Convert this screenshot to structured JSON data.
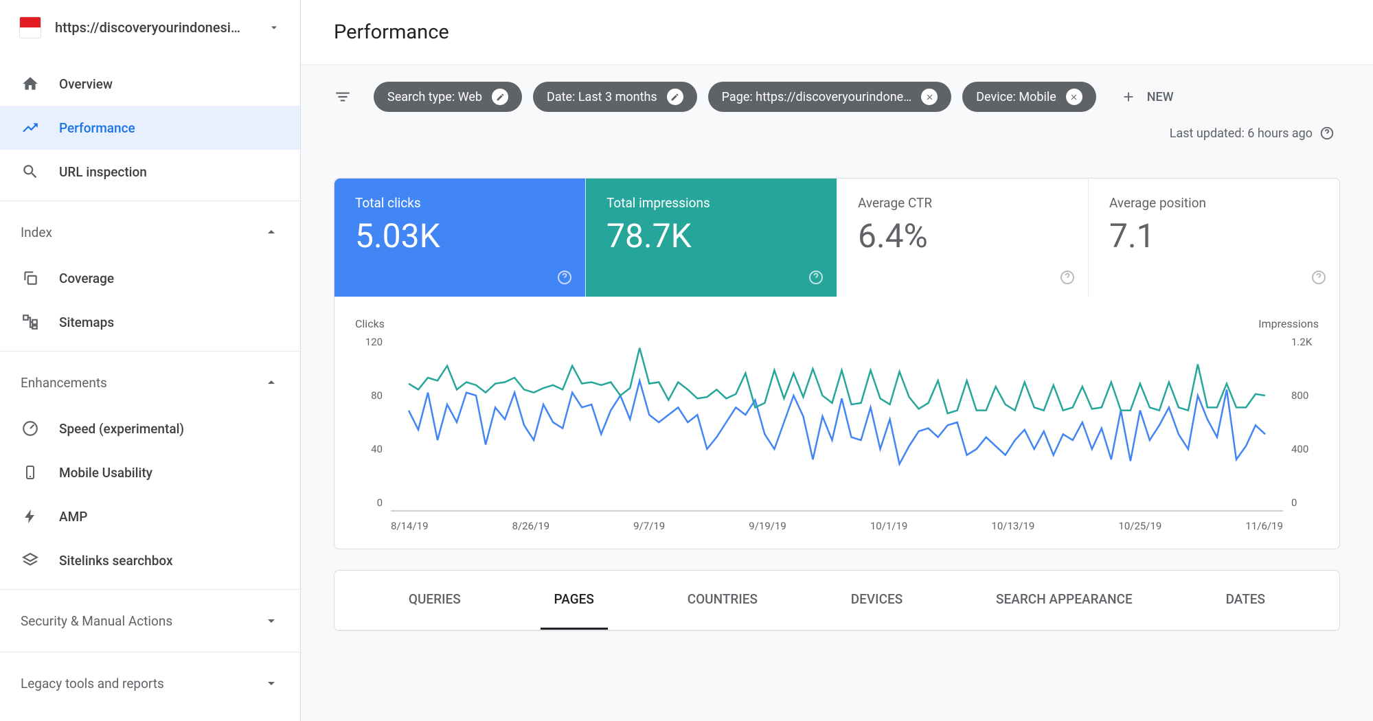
{
  "property": {
    "url": "https://discoveryourindonesi…"
  },
  "sidebar": {
    "overview": "Overview",
    "performance": "Performance",
    "urlinspect": "URL inspection",
    "index": {
      "title": "Index",
      "coverage": "Coverage",
      "sitemaps": "Sitemaps"
    },
    "enhancements": {
      "title": "Enhancements",
      "speed": "Speed (experimental)",
      "mobile": "Mobile Usability",
      "amp": "AMP",
      "sitelinks": "Sitelinks searchbox"
    },
    "security": "Security & Manual Actions",
    "legacy": "Legacy tools and reports"
  },
  "header": {
    "title": "Performance"
  },
  "filters": {
    "searchtype": "Search type: Web",
    "date": "Date: Last 3 months",
    "page": "Page: https://discoveryourindone…",
    "device": "Device: Mobile",
    "new": "NEW",
    "updated": "Last updated: 6 hours ago"
  },
  "metrics": {
    "clicks": {
      "label": "Total clicks",
      "value": "5.03K"
    },
    "impressions": {
      "label": "Total impressions",
      "value": "78.7K"
    },
    "ctr": {
      "label": "Average CTR",
      "value": "6.4%"
    },
    "position": {
      "label": "Average position",
      "value": "7.1"
    }
  },
  "chart": {
    "yLeftLabel": "Clicks",
    "yRightLabel": "Impressions",
    "yLeft": [
      "120",
      "80",
      "40",
      "0"
    ],
    "yRight": [
      "1.2K",
      "800",
      "400",
      "0"
    ],
    "x": [
      "8/14/19",
      "8/26/19",
      "9/7/19",
      "9/19/19",
      "10/1/19",
      "10/13/19",
      "10/25/19",
      "11/6/19"
    ]
  },
  "tabs": [
    "QUERIES",
    "PAGES",
    "COUNTRIES",
    "DEVICES",
    "SEARCH APPEARANCE",
    "DATES"
  ],
  "chart_data": {
    "type": "line",
    "xlabel": "",
    "ylabel_left": "Clicks",
    "ylabel_right": "Impressions",
    "ylim_left": [
      0,
      120
    ],
    "ylim_right": [
      0,
      1200
    ],
    "x_dates": [
      "8/14/19",
      "8/26/19",
      "9/7/19",
      "9/19/19",
      "10/1/19",
      "10/13/19",
      "10/25/19",
      "11/6/19"
    ],
    "series": [
      {
        "name": "Clicks",
        "axis": "left",
        "color": "#4285f4",
        "values": [
          68,
          55,
          80,
          48,
          72,
          60,
          80,
          78,
          45,
          70,
          62,
          80,
          58,
          48,
          72,
          60,
          56,
          80,
          70,
          72,
          52,
          68,
          78,
          62,
          88,
          65,
          60,
          65,
          70,
          60,
          65,
          42,
          50,
          60,
          70,
          65,
          75,
          52,
          42,
          60,
          78,
          64,
          35,
          64,
          48,
          76,
          50,
          48,
          70,
          42,
          62,
          32,
          44,
          54,
          56,
          50,
          58,
          60,
          38,
          42,
          50,
          44,
          38,
          48,
          55,
          42,
          54,
          38,
          52,
          48,
          60,
          42,
          56,
          35,
          68,
          34,
          68,
          48,
          58,
          70,
          52,
          42,
          78,
          62,
          50,
          82,
          35,
          44,
          58,
          52
        ]
      },
      {
        "name": "Impressions",
        "axis": "right",
        "color": "#26a69a",
        "values": [
          860,
          820,
          900,
          880,
          980,
          820,
          870,
          850,
          800,
          860,
          870,
          900,
          820,
          800,
          830,
          850,
          820,
          980,
          860,
          870,
          850,
          870,
          780,
          830,
          1100,
          860,
          870,
          750,
          870,
          820,
          760,
          770,
          820,
          760,
          790,
          930,
          700,
          730,
          950,
          760,
          930,
          770,
          960,
          780,
          730,
          950,
          720,
          730,
          950,
          760,
          720,
          940,
          770,
          690,
          730,
          880,
          660,
          680,
          880,
          680,
          680,
          840,
          720,
          680,
          870,
          700,
          680,
          850,
          680,
          700,
          840,
          690,
          700,
          870,
          680,
          680,
          860,
          700,
          680,
          870,
          700,
          680,
          990,
          700,
          700,
          860,
          700,
          700,
          790,
          780
        ]
      }
    ]
  }
}
